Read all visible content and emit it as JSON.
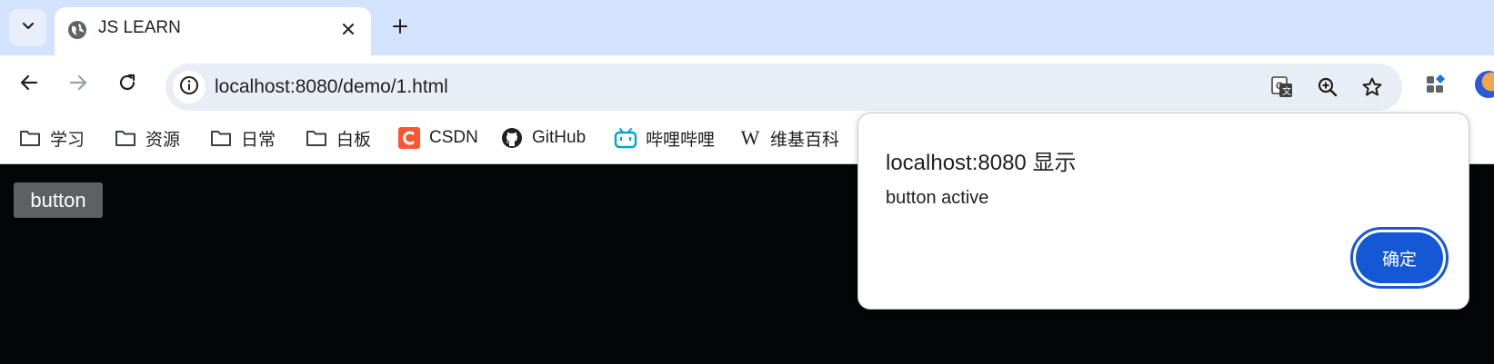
{
  "browser": {
    "tab": {
      "title": "JS LEARN"
    },
    "address_bar": {
      "url": "localhost:8080/demo/1.html"
    },
    "bookmarks": [
      {
        "label": "学习",
        "icon": "folder-icon"
      },
      {
        "label": "资源",
        "icon": "folder-icon"
      },
      {
        "label": "日常",
        "icon": "folder-icon"
      },
      {
        "label": "白板",
        "icon": "folder-icon"
      },
      {
        "label": "CSDN",
        "icon": "csdn-icon"
      },
      {
        "label": "GitHub",
        "icon": "github-icon"
      },
      {
        "label": "哔哩哔哩",
        "icon": "bilibili-icon"
      },
      {
        "label": "维基百科",
        "icon": "wikipedia-icon"
      }
    ]
  },
  "page": {
    "button_label": "button"
  },
  "dialog": {
    "title": "localhost:8080 显示",
    "message": "button active",
    "ok_label": "确定"
  },
  "colors": {
    "tabstrip": "#d3e3fd",
    "page_background": "#030507",
    "dialog_button": "#1558d6"
  }
}
